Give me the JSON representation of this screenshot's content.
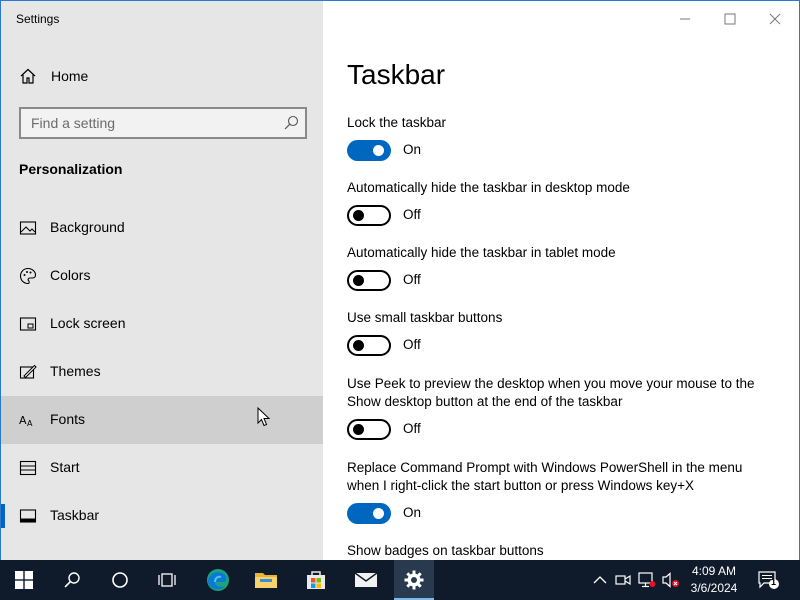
{
  "window": {
    "title": "Settings"
  },
  "sidebar": {
    "home_label": "Home",
    "search_placeholder": "Find a setting",
    "section_title": "Personalization",
    "items": [
      {
        "label": "Background",
        "icon": "picture-icon"
      },
      {
        "label": "Colors",
        "icon": "palette-icon"
      },
      {
        "label": "Lock screen",
        "icon": "lock-screen-icon"
      },
      {
        "label": "Themes",
        "icon": "themes-icon"
      },
      {
        "label": "Fonts",
        "icon": "fonts-icon",
        "hovered": true
      },
      {
        "label": "Start",
        "icon": "start-icon"
      },
      {
        "label": "Taskbar",
        "icon": "taskbar-icon",
        "selected": true
      }
    ]
  },
  "main": {
    "title": "Taskbar",
    "settings": [
      {
        "label": "Lock the taskbar",
        "state": "On"
      },
      {
        "label": "Automatically hide the taskbar in desktop mode",
        "state": "Off"
      },
      {
        "label": "Automatically hide the taskbar in tablet mode",
        "state": "Off"
      },
      {
        "label": "Use small taskbar buttons",
        "state": "Off"
      },
      {
        "label": "Use Peek to preview the desktop when you move your mouse to the Show desktop button at the end of the taskbar",
        "state": "Off"
      },
      {
        "label": "Replace Command Prompt with Windows PowerShell in the menu when I right-click the start button or press Windows key+X",
        "state": "On"
      },
      {
        "label": "Show badges on taskbar buttons"
      }
    ]
  },
  "taskbar": {
    "apps": [
      "start-icon",
      "search-icon",
      "cortana-icon",
      "task-view-icon",
      "edge-icon",
      "file-explorer-icon",
      "store-icon",
      "mail-icon",
      "settings-icon"
    ],
    "active_app": "settings-icon",
    "tray": [
      "show-hidden-icons-chevron",
      "meet-now-icon",
      "network-icon",
      "volume-muted-icon"
    ],
    "time": "4:09 AM",
    "date": "3/6/2024",
    "notification_count": "1"
  },
  "colors": {
    "accent": "#0067c0",
    "sidebar_bg": "#e6e6e6",
    "taskbar_bg": "#0f1b2b"
  }
}
